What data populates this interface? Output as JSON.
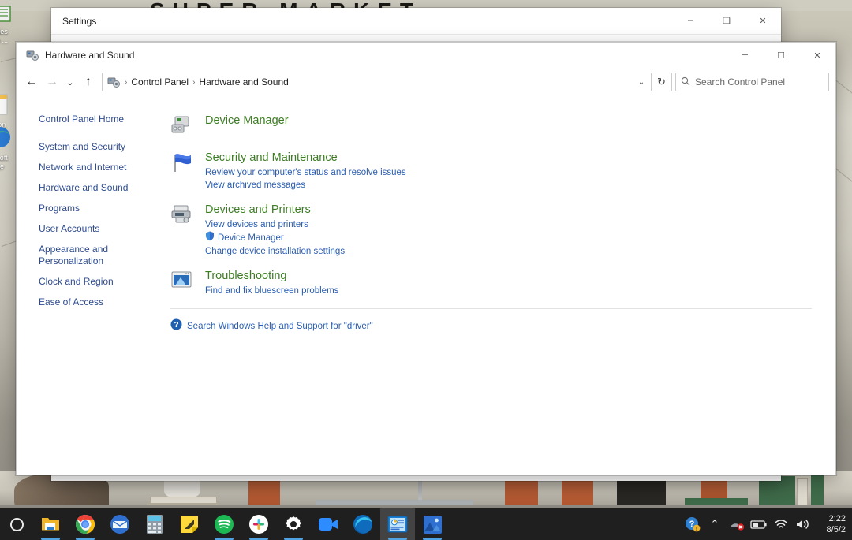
{
  "desktop": {
    "wallpaper_sign_text": "SUPER MARKET",
    "icons": [
      {
        "label_line1": "ories",
        "label_line2": "ub ...",
        "name": "desktop-icon-accessories"
      },
      {
        "label_line1": "tion",
        "label_line2": "ords",
        "name": "desktop-icon-documents"
      },
      {
        "label_line1": "osoft",
        "label_line2": "ge",
        "name": "desktop-icon-microsoft-edge"
      }
    ]
  },
  "settings_window": {
    "title": "Settings",
    "minimize": "–",
    "maximize": "❑",
    "close": "✕"
  },
  "control_panel_window": {
    "title": "Hardware and Sound",
    "title_icon": "hardware-and-sound-icon",
    "minimize": "─",
    "maximize": "☐",
    "close": "✕",
    "nav": {
      "back": "←",
      "forward": "→",
      "recent": "⌄",
      "up": "↑",
      "refresh": "↻",
      "dropdown": "⌄"
    },
    "breadcrumb": {
      "separator": "›",
      "items": [
        "Control Panel",
        "Hardware and Sound"
      ]
    },
    "search": {
      "placeholder": "Search Control Panel",
      "value": "",
      "icon": "search-icon"
    },
    "sidebar": {
      "home": "Control Panel Home",
      "items": [
        "System and Security",
        "Network and Internet",
        "Hardware and Sound",
        "Programs",
        "User Accounts",
        "Appearance and Personalization",
        "Clock and Region",
        "Ease of Access"
      ]
    },
    "categories": [
      {
        "title": "Device Manager",
        "icon": "device-manager-icon",
        "links": []
      },
      {
        "title": "Security and Maintenance",
        "icon": "security-flag-icon",
        "links": [
          {
            "text": "Review your computer's status and resolve issues",
            "shield": false
          },
          {
            "text": "View archived messages",
            "shield": false
          }
        ]
      },
      {
        "title": "Devices and Printers",
        "icon": "printer-icon",
        "links": [
          {
            "text": "View devices and printers",
            "shield": false
          },
          {
            "text": "Device Manager",
            "shield": true
          },
          {
            "text": "Change device installation settings",
            "shield": false
          }
        ]
      },
      {
        "title": "Troubleshooting",
        "icon": "troubleshooting-monitor-icon",
        "links": [
          {
            "text": "Find and fix bluescreen problems",
            "shield": false
          }
        ]
      }
    ],
    "help": {
      "icon": "help-question-icon",
      "text": "Search Windows Help and Support for \"driver\""
    }
  },
  "taskbar": {
    "start_icon": "start-ring-icon",
    "items": [
      {
        "name": "file-explorer",
        "active": false,
        "running": true
      },
      {
        "name": "google-chrome",
        "active": false,
        "running": true
      },
      {
        "name": "mail",
        "active": false,
        "running": false
      },
      {
        "name": "calculator",
        "active": false,
        "running": false
      },
      {
        "name": "sticky-notes",
        "active": false,
        "running": false
      },
      {
        "name": "spotify",
        "active": false,
        "running": true
      },
      {
        "name": "slack",
        "active": false,
        "running": true
      },
      {
        "name": "settings",
        "active": false,
        "running": true
      },
      {
        "name": "zoom",
        "active": false,
        "running": false
      },
      {
        "name": "microsoft-edge",
        "active": false,
        "running": false
      },
      {
        "name": "control-panel",
        "active": true,
        "running": true
      },
      {
        "name": "photos",
        "active": false,
        "running": true
      }
    ],
    "tray": {
      "help_icon": "help-badge-icon",
      "chevron": "⌃",
      "network_off_icon": "network-disconnected-icon",
      "battery_icon": "battery-icon",
      "wifi_icon": "wifi-icon",
      "volume_icon": "volume-icon"
    },
    "clock": {
      "time": "2:22",
      "date": "8/5/2"
    }
  },
  "colors": {
    "heading_green": "#3c7d23",
    "link_blue": "#2a5db0",
    "sidebar_blue": "#2d4b8e",
    "taskbar_bg": "#1f1f1f",
    "accent_underline": "#4fa3e3"
  }
}
